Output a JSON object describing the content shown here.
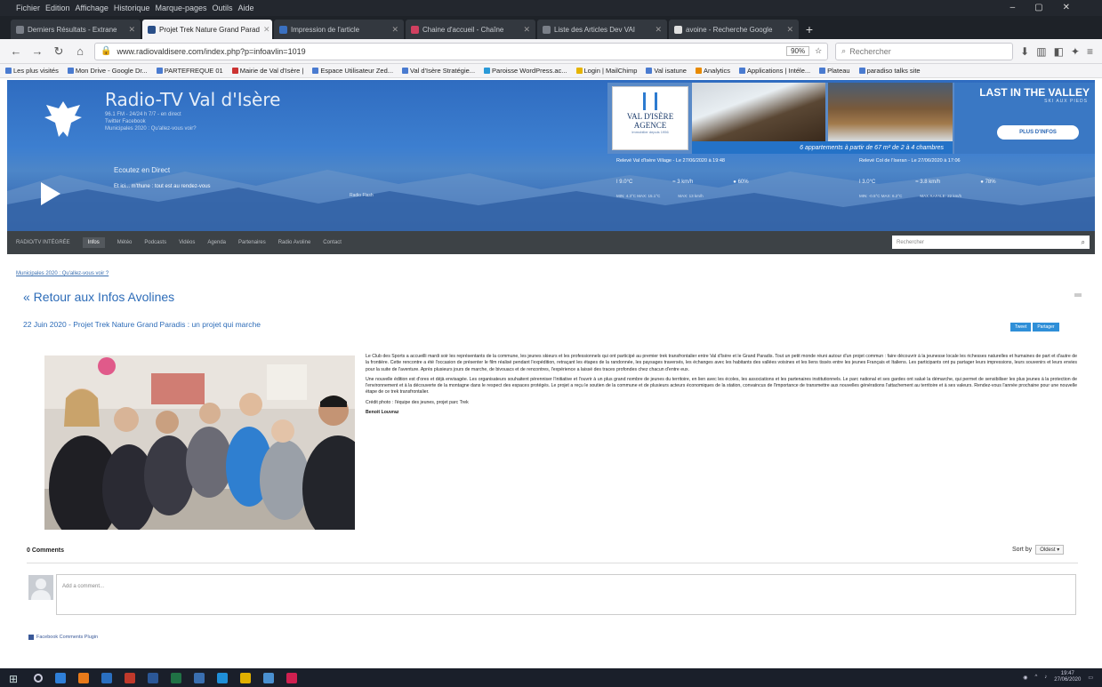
{
  "browser": {
    "menu": [
      "Fichier",
      "Edition",
      "Affichage",
      "Historique",
      "Marque-pages",
      "Outils",
      "Aide"
    ],
    "tabs": [
      {
        "title": "Derniers Résultats - Extrane",
        "active": false
      },
      {
        "title": "Projet Trek Nature Grand Parad",
        "active": true
      },
      {
        "title": "Impression de l'article",
        "active": false
      },
      {
        "title": "Chaine d'accueil - Chaîne",
        "active": false
      },
      {
        "title": "Liste des Articles Dev VAI",
        "active": false
      },
      {
        "title": "avoine - Recherche Google",
        "active": false
      }
    ],
    "url": "www.radiovaldisere.com/index.php?p=infoavlin=1019",
    "zoom": "90%",
    "search_placeholder": "Rechercher",
    "bookmarks": [
      "Les plus visités",
      "Mon Drive - Google Dr...",
      "PARTEFREQUE 01",
      "Mairie de Val d'Isère |",
      "Espace Utilisateur Zed...",
      "Val d'Isère Stratégie...",
      "Paroisse WordPress.ac...",
      "Login | MailChimp",
      "Val isatune",
      "Analytics",
      "Applications | Intéle...",
      "Plateau",
      "paradiso talks site"
    ]
  },
  "header": {
    "station_name": "Radio-TV Val d'Isère",
    "station_sub": "96.1 FM - 24/24 h 7/7 - en direct",
    "station_links": "Twitter   Facebook",
    "station_q": "Municipales 2020 : Qu'allez-vous voir?",
    "live_label": "Ecoutez en Direct",
    "live_program": "Et ici... m'thune : tout est au rendez-vous",
    "live_mid": "Radio Flash",
    "ad": {
      "agency_line1": "VAL D'ISÈRE",
      "agency_line2": "AGENCE",
      "agency_sub": "Immobilier depuis 1956",
      "strip_text": "6 appartements à partir de 67 m² de 2 à 4 chambres",
      "headline": "LAST IN THE VALLEY",
      "sub": "SKI AUX PIEDS",
      "cta": "PLUS D'INFOS"
    },
    "weather_left": {
      "title": "Relevé Val d'Isère Village - Le 27/06/2020 à 19:48",
      "temp": "9.0°C",
      "wind": "3 km/h",
      "humidity": "60%",
      "minmax": "MIN: 4.3°C  MAX: 15.1°C",
      "extra": "MAX: 13 km/h"
    },
    "weather_right": {
      "title": "Relevé Col de l'Iseran - Le 27/06/2020 à 17:06",
      "temp": "3.0°C",
      "wind": "3.8 km/h",
      "humidity": "78%",
      "minmax": "MIN: -0.5°C  MAX: 6.2°C",
      "extra": "MAX RAFALE: 22 km/h"
    }
  },
  "nav": {
    "items": [
      "RADIO/TV INTÉGRÉE",
      "Infos",
      "Météo",
      "Podcasts",
      "Vidéos",
      "Agenda",
      "Partenaires",
      "Radio Avoline",
      "Contact"
    ],
    "active_index": 1,
    "search_placeholder": "Rechercher"
  },
  "content": {
    "breadcrumb": "Municipales 2020 : Qu'allez-vous voir ?",
    "back_link": "« Retour aux Infos Avolines",
    "article_title": "22 Juin 2020 - Projet Trek Nature Grand Paradis : un projet qui marche",
    "share_buttons": [
      "Tweet",
      "Partager"
    ],
    "body_paragraphs": [
      "Le Club des Sports a accueilli mardi soir les représentants de la commune, les jeunes skieurs et les professionnels qui ont participé au premier trek transfrontalier entre Val d'Isère et le Grand Paradis. Tout un petit monde réuni autour d'un projet commun : faire découvrir à la jeunesse locale les richesses naturelles et humaines de part et d'autre de la frontière. Cette rencontre a été l'occasion de présenter le film réalisé pendant l'expédition, retraçant les étapes de la randonnée, les paysages traversés, les échanges avec les habitants des vallées voisines et les liens tissés entre les jeunes Français et Italiens. Les participants ont pu partager leurs impressions, leurs souvenirs et leurs envies pour la suite de l'aventure. Après plusieurs jours de marche, de bivouacs et de rencontres, l'expérience a laissé des traces profondes chez chacun d'entre eux.",
      "Une nouvelle édition est d'ores et déjà envisagée. Les organisateurs souhaitent pérenniser l'initiative et l'ouvrir à un plus grand nombre de jeunes du territoire, en lien avec les écoles, les associations et les partenaires institutionnels. Le parc national et ses gardes ont salué la démarche, qui permet de sensibiliser les plus jeunes à la protection de l'environnement et à la découverte de la montagne dans le respect des espaces protégés. Le projet a reçu le soutien de la commune et de plusieurs acteurs économiques de la station, convaincus de l'importance de transmettre aux nouvelles générations l'attachement au territoire et à ses valeurs. Rendez-vous l'année prochaine pour une nouvelle étape de ce trek transfrontalier.",
      "Crédit photo : l'équipe des jeunes, projet parc Trek",
      "Benoit Louvraz"
    ]
  },
  "comments": {
    "count_label": "0 Comments",
    "sort_label": "Sort by",
    "sort_value": "Oldest",
    "placeholder": "Add a comment...",
    "plugin_label": "Facebook Comments Plugin"
  },
  "taskbar": {
    "time": "19:47",
    "date": "27/06/2020"
  }
}
